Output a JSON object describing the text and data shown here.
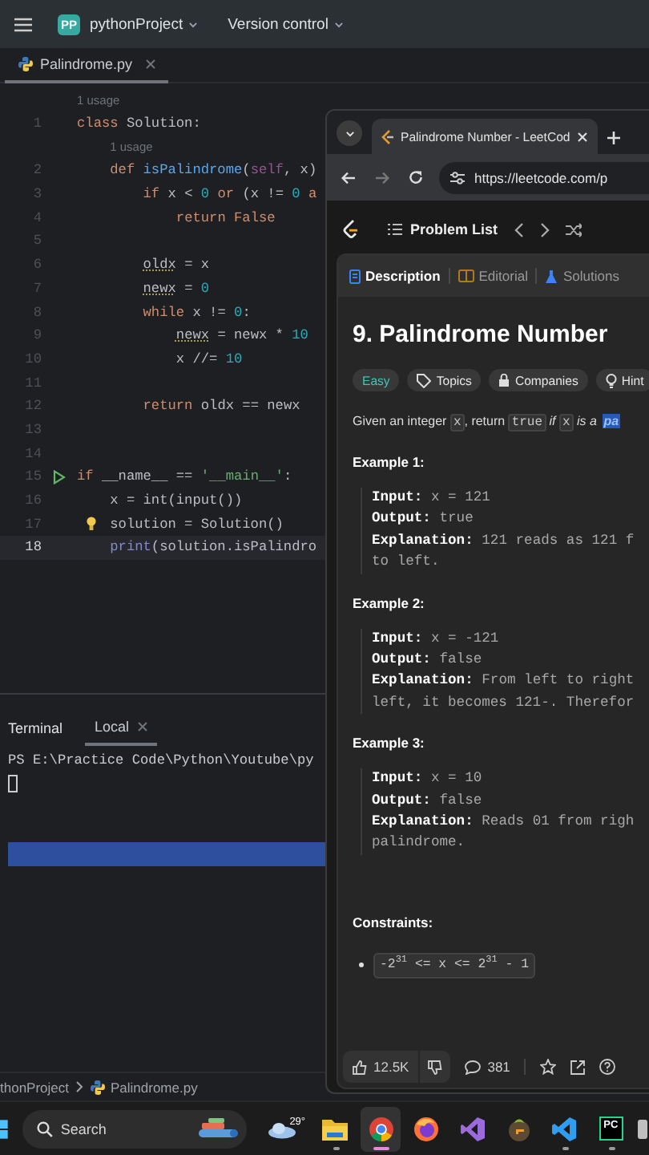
{
  "ide": {
    "badge": "PP",
    "project": "pythonProject",
    "vcs": "Version control"
  },
  "file_tabs": [
    {
      "label": "Palindrome.py",
      "selected": true
    }
  ],
  "editor": {
    "lines": [
      {
        "kind": "hint",
        "text": "1 usage"
      },
      {
        "kind": "code",
        "number": "1",
        "current": false,
        "runnable": false,
        "bulb": false,
        "tokens": [
          {
            "kind": "kw",
            "text": "class"
          },
          {
            "kind": "plain",
            "text": " Solution:"
          }
        ],
        "children": [
          {
            "kind": "hint",
            "text": "1 usage"
          },
          {
            "kind": "code",
            "number": "2",
            "current": false,
            "runnable": false,
            "bulb": false,
            "tokens": [
              {
                "kind": "kw",
                "text": "def "
              },
              {
                "kind": "fn",
                "text": "isPalindrome"
              },
              {
                "kind": "plain",
                "text": "("
              },
              {
                "kind": "self",
                "text": "self"
              },
              {
                "kind": "plain",
                "text": ", x)"
              }
            ],
            "children": [
              {
                "kind": "code",
                "number": "3",
                "current": false,
                "runnable": false,
                "bulb": false,
                "tokens": [
                  {
                    "kind": "kw",
                    "text": "if"
                  },
                  {
                    "kind": "plain",
                    "text": " x < "
                  },
                  {
                    "kind": "num",
                    "text": "0"
                  },
                  {
                    "kind": "kw",
                    "text": " or"
                  },
                  {
                    "kind": "plain",
                    "text": " (x != "
                  },
                  {
                    "kind": "num",
                    "text": "0"
                  },
                  {
                    "kind": "kw",
                    "text": " a"
                  }
                ],
                "children": [
                  {
                    "kind": "code",
                    "number": "4",
                    "current": false,
                    "runnable": false,
                    "bulb": false,
                    "tokens": [
                      {
                        "kind": "kw",
                        "text": "return False"
                      }
                    ]
                  }
                ]
              },
              {
                "kind": "code",
                "number": "5",
                "current": false,
                "runnable": false,
                "bulb": false
              },
              {
                "kind": "code",
                "number": "6",
                "current": false,
                "runnable": false,
                "bulb": false,
                "tokens": [
                  {
                    "kind": "warn",
                    "text": "oldx"
                  },
                  {
                    "kind": "plain",
                    "text": " = x"
                  }
                ]
              },
              {
                "kind": "code",
                "number": "7",
                "current": false,
                "runnable": false,
                "bulb": false,
                "tokens": [
                  {
                    "kind": "warn",
                    "text": "newx"
                  },
                  {
                    "kind": "plain",
                    "text": " = "
                  },
                  {
                    "kind": "num",
                    "text": "0"
                  }
                ]
              },
              {
                "kind": "code",
                "number": "8",
                "current": false,
                "runnable": false,
                "bulb": false,
                "tokens": [
                  {
                    "kind": "kw",
                    "text": "while"
                  },
                  {
                    "kind": "plain",
                    "text": " x != "
                  },
                  {
                    "kind": "num",
                    "text": "0"
                  },
                  {
                    "kind": "plain",
                    "text": ":"
                  }
                ],
                "children": [
                  {
                    "kind": "code",
                    "number": "9",
                    "current": false,
                    "runnable": false,
                    "bulb": false,
                    "tokens": [
                      {
                        "kind": "warn",
                        "text": "newx"
                      },
                      {
                        "kind": "plain",
                        "text": " = newx * "
                      },
                      {
                        "kind": "num",
                        "text": "10"
                      }
                    ]
                  },
                  {
                    "kind": "code",
                    "number": "10",
                    "current": false,
                    "runnable": false,
                    "bulb": false,
                    "tokens": [
                      {
                        "kind": "plain",
                        "text": "x //= "
                      },
                      {
                        "kind": "num",
                        "text": "10"
                      }
                    ]
                  }
                ]
              },
              {
                "kind": "code",
                "number": "11",
                "current": false,
                "runnable": false,
                "bulb": false
              },
              {
                "kind": "code",
                "number": "12",
                "current": false,
                "runnable": false,
                "bulb": false,
                "tokens": [
                  {
                    "kind": "kw",
                    "text": "return"
                  },
                  {
                    "kind": "plain",
                    "text": " oldx == newx"
                  }
                ]
              }
            ]
          }
        ]
      },
      {
        "kind": "code",
        "number": "13",
        "current": false,
        "runnable": false,
        "bulb": false
      },
      {
        "kind": "code",
        "number": "14",
        "current": false,
        "runnable": false,
        "bulb": false
      },
      {
        "kind": "code",
        "number": "15",
        "current": false,
        "runnable": true,
        "bulb": false,
        "tokens": [
          {
            "kind": "kw",
            "text": "if"
          },
          {
            "kind": "plain",
            "text": " __name__ == "
          },
          {
            "kind": "str",
            "text": "'__main__'"
          },
          {
            "kind": "plain",
            "text": ":"
          }
        ],
        "children": [
          {
            "kind": "code",
            "number": "16",
            "current": false,
            "runnable": false,
            "bulb": false,
            "tokens": [
              {
                "kind": "plain",
                "text": "x = int(input())"
              }
            ]
          },
          {
            "kind": "code",
            "number": "17",
            "current": false,
            "runnable": false,
            "bulb": true,
            "tokens": [
              {
                "kind": "plain",
                "text": "solution = Solution()"
              }
            ]
          },
          {
            "kind": "code",
            "number": "18",
            "current": true,
            "runnable": false,
            "bulb": false,
            "tokens": [
              {
                "kind": "builtin",
                "text": "print"
              },
              {
                "kind": "plain",
                "text": "(solution.isPalindro"
              }
            ]
          }
        ]
      }
    ]
  },
  "terminal": {
    "title": "Terminal",
    "tabs": [
      {
        "label": "Local",
        "selected": true
      }
    ],
    "lines": [
      "PS E:\\Practice Code\\Python\\Youtube\\py"
    ]
  },
  "status_bar": {
    "path": [
      "thonProject",
      "Palindrome.py"
    ]
  },
  "browser": {
    "tabs": [
      {
        "title": "Palindrome Number - LeetCod",
        "selected": true
      }
    ],
    "url": "https://leetcode.com/p",
    "page": {
      "nav_title": "Problem List",
      "panel_tabs": [
        {
          "label": "Description",
          "kind": "description",
          "selected": true
        },
        {
          "label": "Editorial",
          "kind": "editorial",
          "selected": false
        },
        {
          "label": "Solutions",
          "kind": "solutions",
          "selected": false
        }
      ],
      "title": "9. Palindrome Number",
      "tags": [
        {
          "label": "Easy",
          "kind": "difficulty"
        },
        {
          "label": "Topics",
          "kind": "topics"
        },
        {
          "label": "Companies",
          "kind": "companies"
        },
        {
          "label": "Hint",
          "kind": "hint"
        }
      ],
      "statement": [
        {
          "kind": "text",
          "text": "Given an integer "
        },
        {
          "kind": "code",
          "text": "x"
        },
        {
          "kind": "text",
          "text": ", return "
        },
        {
          "kind": "code",
          "text": "true"
        },
        {
          "kind": "em",
          "text": " if "
        },
        {
          "kind": "code",
          "text": "x"
        },
        {
          "kind": "em",
          "text": " is a "
        },
        {
          "kind": "highlight",
          "text": "pa"
        }
      ],
      "examples": [
        {
          "heading": "Example 1:",
          "lines": [
            {
              "label": "Input:",
              "value": "x = 121"
            },
            {
              "label": "Output:",
              "value": "true"
            },
            {
              "label": "Explanation:",
              "value": "121 reads as 121 f"
            },
            {
              "value": "to left."
            }
          ]
        },
        {
          "heading": "Example 2:",
          "lines": [
            {
              "label": "Input:",
              "value": "x = -121"
            },
            {
              "label": "Output:",
              "value": "false"
            },
            {
              "label": "Explanation:",
              "value": "From left to right"
            },
            {
              "value": "left, it becomes 121-. Therefor"
            }
          ]
        },
        {
          "heading": "Example 3:",
          "lines": [
            {
              "label": "Input:",
              "value": "x = 10"
            },
            {
              "label": "Output:",
              "value": "false"
            },
            {
              "label": "Explanation:",
              "value": "Reads 01 from righ"
            },
            {
              "value": "palindrome."
            }
          ]
        }
      ],
      "constraints_heading": "Constraints:",
      "constraints": [
        "-2$^{31}$ <= x <= 2$^{31}$ - 1"
      ],
      "likes": "12.5K",
      "comments": "381"
    }
  },
  "taskbar": {
    "search": "Search",
    "temperature": "29°",
    "apps": [
      {
        "kind": "explorer",
        "running": true,
        "selected": false
      },
      {
        "kind": "chrome",
        "running": true,
        "selected": true
      },
      {
        "kind": "firefox",
        "running": false,
        "selected": false
      },
      {
        "kind": "visualstudio",
        "running": false,
        "selected": false
      },
      {
        "kind": "flstudio",
        "running": false,
        "selected": false
      },
      {
        "kind": "vscode",
        "running": true,
        "selected": false
      },
      {
        "kind": "pycharm",
        "label": "PC",
        "running": true,
        "selected": false
      },
      {
        "kind": "generic",
        "running": false,
        "selected": false
      }
    ]
  }
}
